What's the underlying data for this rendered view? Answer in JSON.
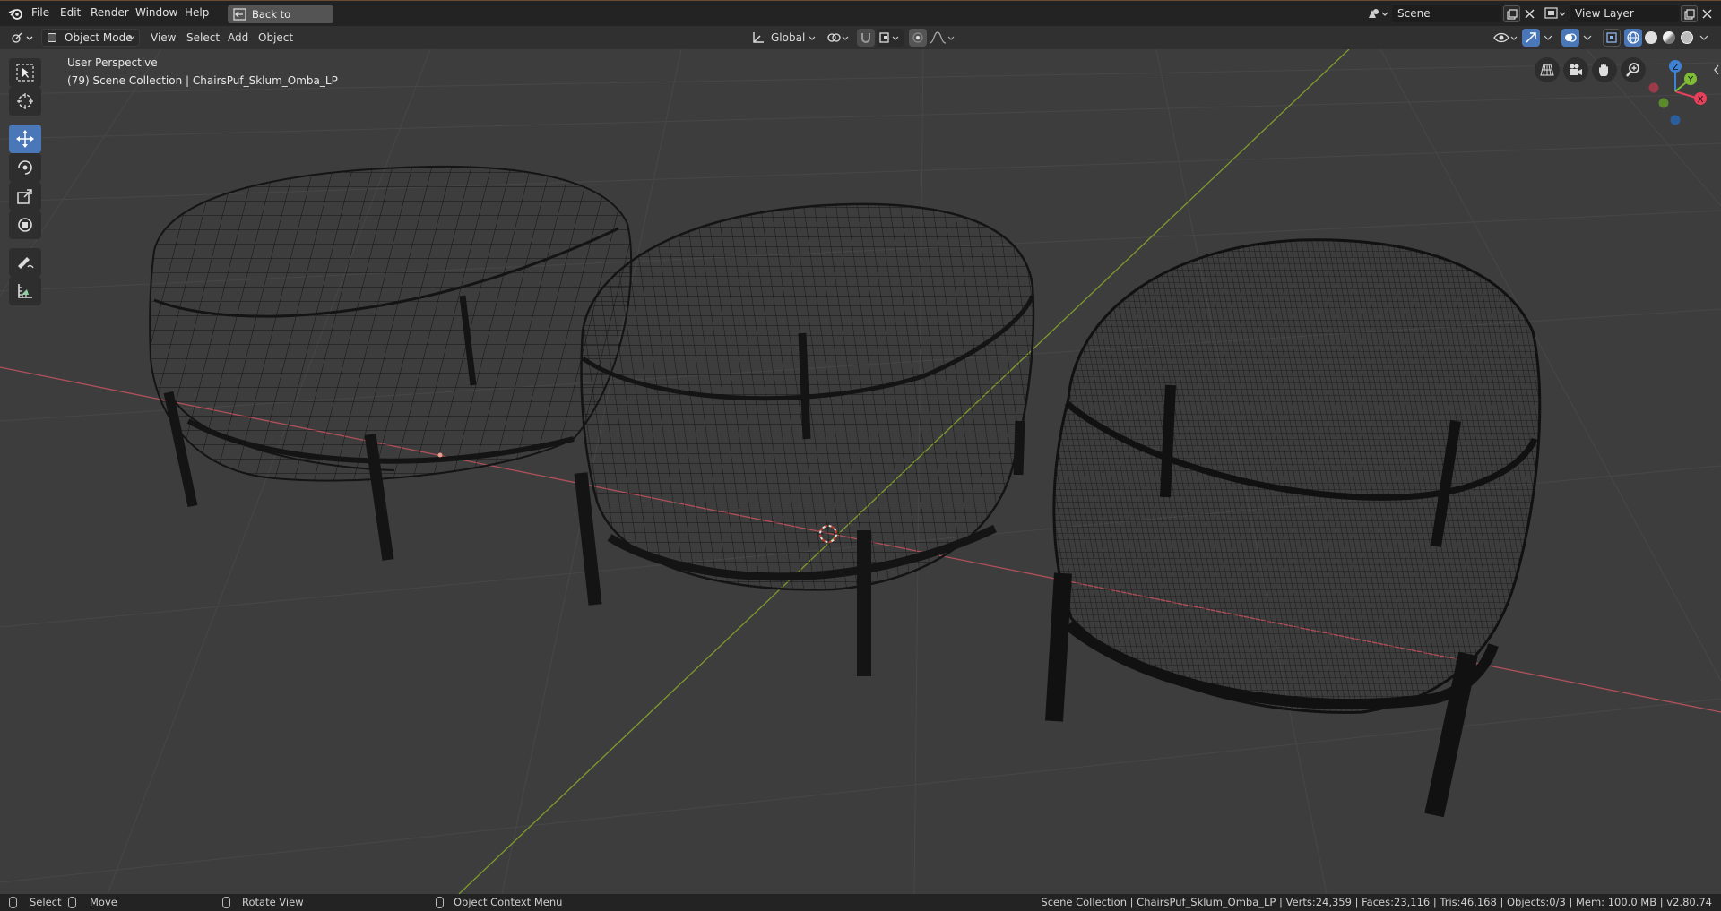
{
  "menu": {
    "items": [
      "File",
      "Edit",
      "Render",
      "Window",
      "Help"
    ],
    "back_to_previous": "Back to Previous",
    "scene_name": "Scene",
    "view_layer": "View Layer"
  },
  "header": {
    "mode": "Object Mode",
    "menus": [
      "View",
      "Select",
      "Add",
      "Object"
    ],
    "orientation": "Global"
  },
  "viewport": {
    "view_name": "User Perspective",
    "collection_info": "(79) Scene Collection | ChairsPuf_Sklum_Omba_LP",
    "gizmo": {
      "x": "X",
      "y": "Y",
      "z": "Z"
    }
  },
  "toolbar": {
    "tools": [
      "select-box",
      "cursor",
      "move",
      "rotate",
      "scale",
      "transform",
      "annotate",
      "measure"
    ],
    "active": "move"
  },
  "statusbar": {
    "select": "Select",
    "move": "Move",
    "rotate_view": "Rotate View",
    "context_menu": "Object Context Menu",
    "stats": "Scene Collection | ChairsPuf_Sklum_Omba_LP | Verts:24,359 | Faces:23,116 | Tris:46,168 | Objects:0/3 | Mem: 100.0 MB | v2.80.74"
  },
  "colors": {
    "viewport_bg": "#3d3d3d",
    "grid": "#474747",
    "x_axis": "#b0505a",
    "y_axis": "#7f9a2e",
    "active_tool": "#4a77b8",
    "gizmo_x": "#e8405a",
    "gizmo_y": "#7fbc36",
    "gizmo_z": "#3e82d6"
  }
}
